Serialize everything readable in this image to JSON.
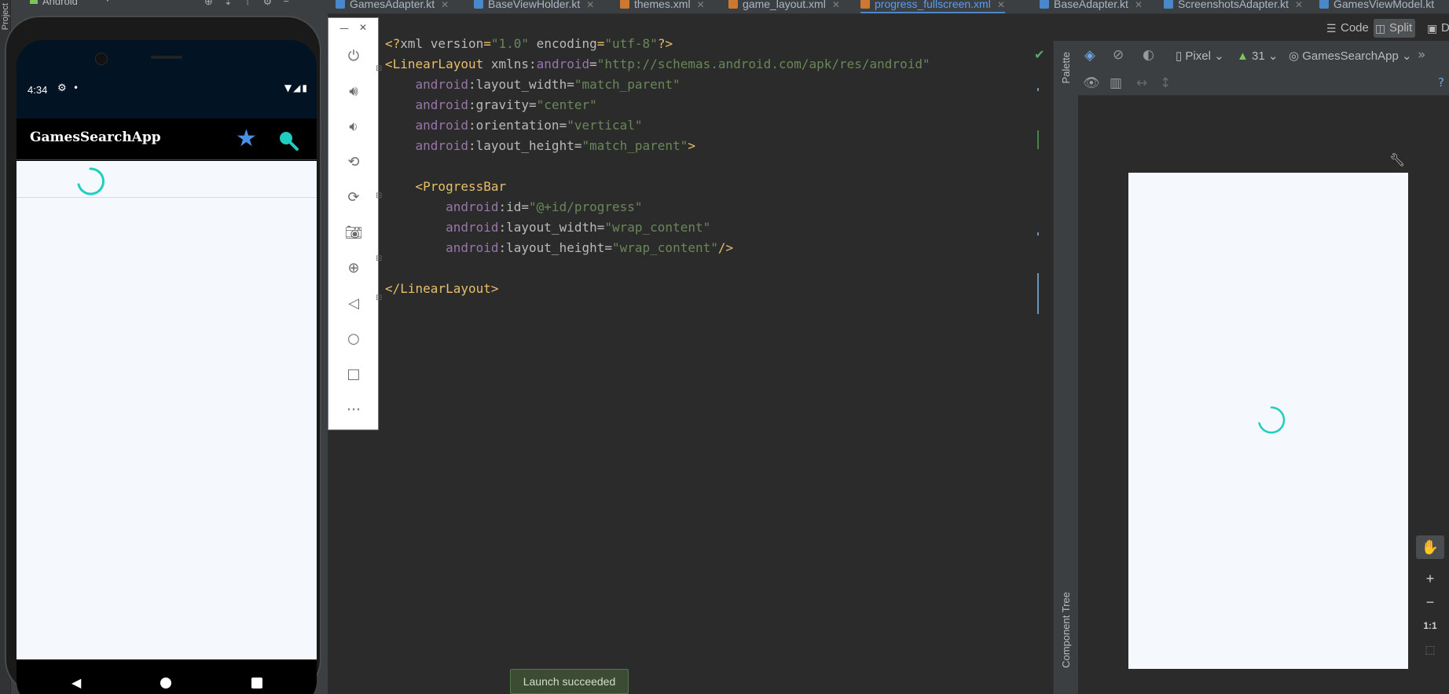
{
  "project_panel": {
    "view_label": "Android",
    "rail_label": "Project"
  },
  "editor_tabs": [
    {
      "label": "GamesAdapter.kt",
      "icon_color": "#4a88c7"
    },
    {
      "label": "BaseViewHolder.kt",
      "icon_color": "#4a88c7"
    },
    {
      "label": "themes.xml",
      "icon_color": "#cc7832"
    },
    {
      "label": "game_layout.xml",
      "icon_color": "#cc7832"
    },
    {
      "label": "progress_fullscreen.xml",
      "icon_color": "#cc7832",
      "active": true
    },
    {
      "label": "BaseAdapter.kt",
      "icon_color": "#4a88c7"
    },
    {
      "label": "ScreenshotsAdapter.kt",
      "icon_color": "#4a88c7"
    },
    {
      "label": "GamesViewModel.kt",
      "icon_color": "#4a88c7"
    }
  ],
  "view_modes": {
    "code": "Code",
    "split": "Split",
    "design": "D"
  },
  "phone": {
    "status_time": "4:34",
    "app_title": "GamesSearchApp",
    "accent_color": "#1ecfc0",
    "star_color": "#4a90e2",
    "status_icons": {
      "settings": "gear-icon",
      "notification": "dot-icon",
      "wifi": "wifi-icon",
      "signal": "signal-icon",
      "battery": "battery-icon"
    }
  },
  "emulator_toolbar": {
    "items": [
      "power-icon",
      "volume-up-icon",
      "volume-down-icon",
      "rotate-left-icon",
      "rotate-right-icon",
      "camera-icon",
      "zoom-icon",
      "back-icon",
      "home-icon",
      "overview-icon",
      "more-icon"
    ]
  },
  "code": {
    "lines": [
      [
        [
          "c-punc",
          "<?"
        ],
        [
          "c-attr",
          "xml version"
        ],
        [
          "c-punc",
          "="
        ],
        [
          "c-val",
          "\"1.0\""
        ],
        [
          "c-attr",
          " encoding"
        ],
        [
          "c-punc",
          "="
        ],
        [
          "c-val",
          "\"utf-8\""
        ],
        [
          "c-punc",
          "?>"
        ]
      ],
      [
        [
          "c-tag",
          "<LinearLayout"
        ],
        [
          "c-attr",
          " xmlns:"
        ],
        [
          "c-attrns",
          "android"
        ],
        [
          "c-attr",
          "="
        ],
        [
          "c-val",
          "\"http://schemas.android.com/apk/res/android\""
        ]
      ],
      [
        [
          "c-attr",
          "    "
        ],
        [
          "c-attrns",
          "android"
        ],
        [
          "c-attr",
          ":layout_width="
        ],
        [
          "c-val",
          "\"match_parent\""
        ]
      ],
      [
        [
          "c-attr",
          "    "
        ],
        [
          "c-attrns",
          "android"
        ],
        [
          "c-attr",
          ":gravity="
        ],
        [
          "c-val",
          "\"center\""
        ]
      ],
      [
        [
          "c-attr",
          "    "
        ],
        [
          "c-attrns",
          "android"
        ],
        [
          "c-attr",
          ":orientation="
        ],
        [
          "c-val",
          "\"vertical\""
        ]
      ],
      [
        [
          "c-attr",
          "    "
        ],
        [
          "c-attrns",
          "android"
        ],
        [
          "c-attr",
          ":layout_height="
        ],
        [
          "c-val",
          "\"match_parent\""
        ],
        [
          "c-tag",
          ">"
        ]
      ],
      [],
      [
        [
          "c-attr",
          "    "
        ],
        [
          "c-tag",
          "<ProgressBar"
        ]
      ],
      [
        [
          "c-attr",
          "        "
        ],
        [
          "c-attrns",
          "android"
        ],
        [
          "c-attr",
          ":id="
        ],
        [
          "c-val",
          "\"@+id/progress\""
        ]
      ],
      [
        [
          "c-attr",
          "        "
        ],
        [
          "c-attrns",
          "android"
        ],
        [
          "c-attr",
          ":layout_width="
        ],
        [
          "c-val",
          "\"wrap_content\""
        ]
      ],
      [
        [
          "c-attr",
          "        "
        ],
        [
          "c-attrns",
          "android"
        ],
        [
          "c-attr",
          ":layout_height="
        ],
        [
          "c-val",
          "\"wrap_content\""
        ],
        [
          "c-tag",
          "/>"
        ]
      ],
      [],
      [
        [
          "c-tag",
          "</LinearLayout>"
        ]
      ]
    ]
  },
  "design_toolbar": {
    "device": "Pixel",
    "api_level": "31",
    "theme": "GamesSearchApp"
  },
  "side_rails": {
    "palette": "Palette",
    "component_tree": "Component Tree"
  },
  "zoom_controls": {
    "zoom_in": "+",
    "zoom_out": "−",
    "ratio": "1:1"
  },
  "toast": {
    "message": "Launch succeeded"
  }
}
